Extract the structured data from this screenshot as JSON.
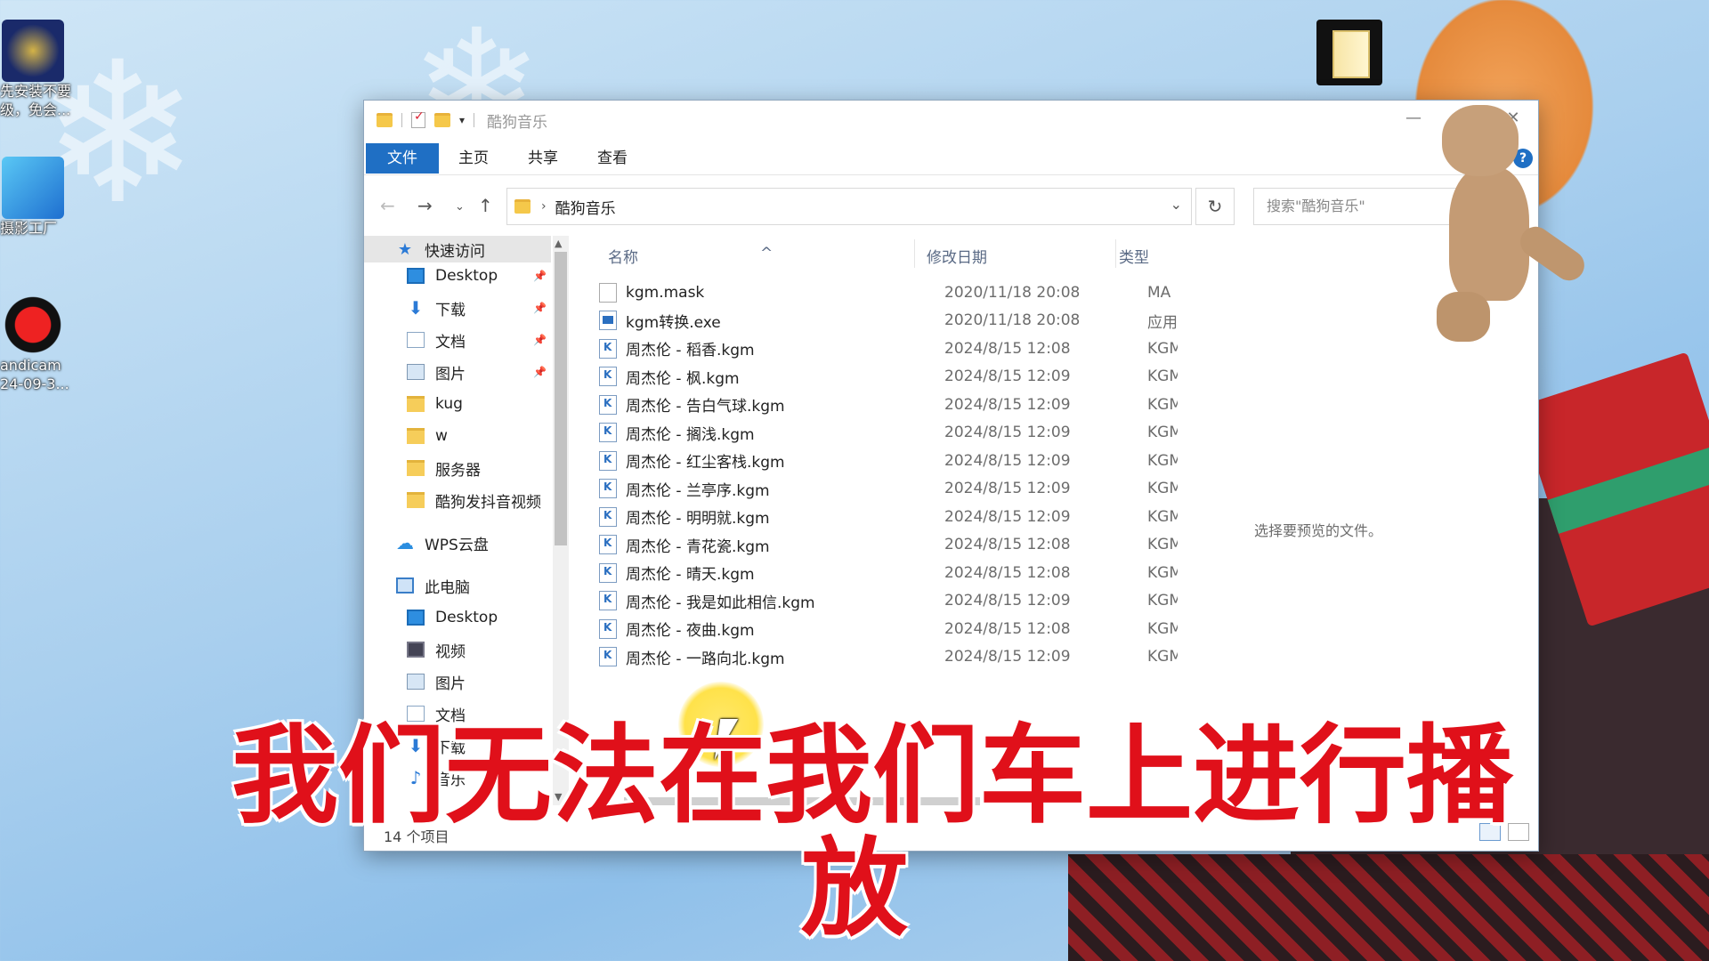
{
  "desktop": {
    "icons": [
      {
        "label": "先安装不要",
        "label2": "级，免会..."
      },
      {
        "label": "摄影工厂",
        "label2": ""
      },
      {
        "label": "andicam",
        "label2": "24-09-3..."
      }
    ]
  },
  "window": {
    "title": "酷狗音乐",
    "buttons": {
      "minimize": "—",
      "maximize": "☐",
      "close": "✕"
    },
    "ribbon_tabs": [
      "文件",
      "主页",
      "共享",
      "查看"
    ],
    "help": "?",
    "address": {
      "path": "酷狗音乐"
    },
    "search_placeholder": "搜索\"酷狗音乐\"",
    "nav_pane": {
      "quick_access": "快速访问",
      "items": [
        "Desktop",
        "下载",
        "文档",
        "图片",
        "kug",
        "w",
        "服务器",
        "酷狗发抖音视频"
      ],
      "wps": "WPS云盘",
      "this_pc": "此电脑",
      "pc_items": [
        "Desktop",
        "视频",
        "图片",
        "文档",
        "下载",
        "音乐"
      ]
    },
    "columns": {
      "name": "名称",
      "date": "修改日期",
      "type": "类型"
    },
    "files": [
      {
        "name": "kgm.mask",
        "date": "2020/11/18 20:08",
        "type": "MA",
        "icon": "mask"
      },
      {
        "name": "kgm转换.exe",
        "date": "2020/11/18 20:08",
        "type": "应用",
        "icon": "exe"
      },
      {
        "name": "周杰伦 - 稻香.kgm",
        "date": "2024/8/15 12:08",
        "type": "KGM",
        "icon": "kgm"
      },
      {
        "name": "周杰伦 - 枫.kgm",
        "date": "2024/8/15 12:09",
        "type": "KGM",
        "icon": "kgm"
      },
      {
        "name": "周杰伦 - 告白气球.kgm",
        "date": "2024/8/15 12:09",
        "type": "KGM",
        "icon": "kgm"
      },
      {
        "name": "周杰伦 - 搁浅.kgm",
        "date": "2024/8/15 12:09",
        "type": "KGM",
        "icon": "kgm"
      },
      {
        "name": "周杰伦 - 红尘客栈.kgm",
        "date": "2024/8/15 12:09",
        "type": "KGM",
        "icon": "kgm"
      },
      {
        "name": "周杰伦 - 兰亭序.kgm",
        "date": "2024/8/15 12:09",
        "type": "KGM",
        "icon": "kgm"
      },
      {
        "name": "周杰伦 - 明明就.kgm",
        "date": "2024/8/15 12:09",
        "type": "KGM",
        "icon": "kgm"
      },
      {
        "name": "周杰伦 - 青花瓷.kgm",
        "date": "2024/8/15 12:08",
        "type": "KGM",
        "icon": "kgm"
      },
      {
        "name": "周杰伦 - 晴天.kgm",
        "date": "2024/8/15 12:08",
        "type": "KGM",
        "icon": "kgm"
      },
      {
        "name": "周杰伦 - 我是如此相信.kgm",
        "date": "2024/8/15 12:09",
        "type": "KGM",
        "icon": "kgm"
      },
      {
        "name": "周杰伦 - 夜曲.kgm",
        "date": "2024/8/15 12:08",
        "type": "KGM",
        "icon": "kgm"
      },
      {
        "name": "周杰伦 - 一路向北.kgm",
        "date": "2024/8/15 12:09",
        "type": "KGM",
        "icon": "kgm"
      }
    ],
    "preview_text": "选择要预览的文件。",
    "status": "14 个项目"
  },
  "subtitle": {
    "line1": "我们无法在我们车上进行播",
    "line2": "放"
  },
  "colors": {
    "accent": "#1f6fc4",
    "subtitle": "#e0101a"
  }
}
